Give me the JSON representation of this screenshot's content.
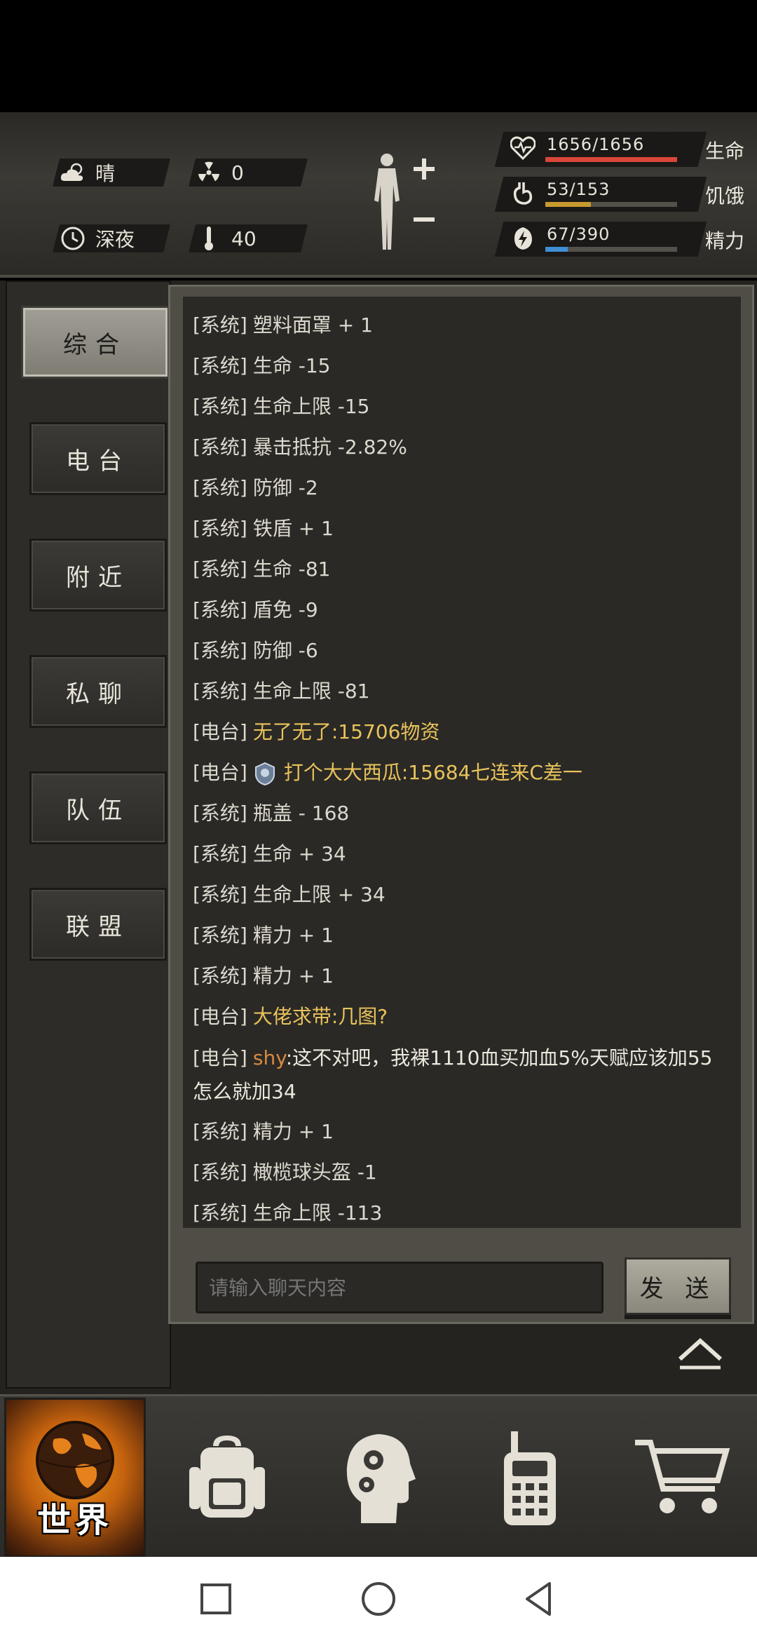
{
  "status": {
    "weather": {
      "icon": "cloud-sun-icon",
      "text": "晴"
    },
    "radiation": {
      "icon": "radiation-icon",
      "value": "0"
    },
    "time": {
      "icon": "clock-icon",
      "text": "深夜"
    },
    "temperature": {
      "icon": "thermometer-icon",
      "value": "40"
    },
    "health": {
      "value": "1656/1656",
      "label": "生命",
      "fraction": 1.0,
      "color": "#d9473a"
    },
    "hunger": {
      "value": "53/153",
      "label": "饥饿",
      "fraction": 0.346,
      "color": "#c89a2e"
    },
    "energy": {
      "value": "67/390",
      "label": "精力",
      "fraction": 0.172,
      "color": "#3e8fd6"
    }
  },
  "tabs": [
    "综合",
    "电台",
    "附近",
    "私聊",
    "队伍",
    "联盟"
  ],
  "active_tab": 0,
  "messages": [
    {
      "tag": "[系统]",
      "text": "塑料面罩 + 1"
    },
    {
      "tag": "[系统]",
      "text": "生命 -15"
    },
    {
      "tag": "[系统]",
      "text": "生命上限 -15"
    },
    {
      "tag": "[系统]",
      "text": "暴击抵抗 -2.82%"
    },
    {
      "tag": "[系统]",
      "text": "防御 -2"
    },
    {
      "tag": "[系统]",
      "text": "铁盾 + 1"
    },
    {
      "tag": "[系统]",
      "text": "生命 -81"
    },
    {
      "tag": "[系统]",
      "text": "盾免 -9"
    },
    {
      "tag": "[系统]",
      "text": "防御 -6"
    },
    {
      "tag": "[系统]",
      "text": "生命上限 -81"
    },
    {
      "tag": "[电台]",
      "name": "无了无了",
      "text": ":15706物资"
    },
    {
      "tag": "[电台]",
      "name": "打个大大西瓜",
      "text": ":15684七连来C差一",
      "badge": true
    },
    {
      "tag": "[系统]",
      "text": "瓶盖 - 168"
    },
    {
      "tag": "[系统]",
      "text": "生命 + 34"
    },
    {
      "tag": "[系统]",
      "text": "生命上限 + 34"
    },
    {
      "tag": "[系统]",
      "text": "精力 + 1"
    },
    {
      "tag": "[系统]",
      "text": "精力 + 1"
    },
    {
      "tag": "[电台]",
      "name": "大佬求带",
      "text": ":几图?"
    },
    {
      "tag": "[电台]",
      "name": "shy",
      "text": ":这不对吧，我裸1110血买加血5%天赋应该加55怎么就加34",
      "wrap": true,
      "name_style": "shy"
    },
    {
      "tag": "[系统]",
      "text": "精力 + 1"
    },
    {
      "tag": "[系统]",
      "text": "橄榄球头盔 -1"
    },
    {
      "tag": "[系统]",
      "text": "生命上限 -113"
    }
  ],
  "chat_input": {
    "placeholder": "请输入聊天内容",
    "value": ""
  },
  "send_label": "发 送",
  "nav": [
    {
      "label": "世界",
      "icon": "globe-icon",
      "active": true
    },
    {
      "label": "",
      "icon": "backpack-icon"
    },
    {
      "label": "",
      "icon": "head-gears-icon"
    },
    {
      "label": "",
      "icon": "walkie-talkie-icon"
    },
    {
      "label": "",
      "icon": "cart-icon"
    }
  ]
}
